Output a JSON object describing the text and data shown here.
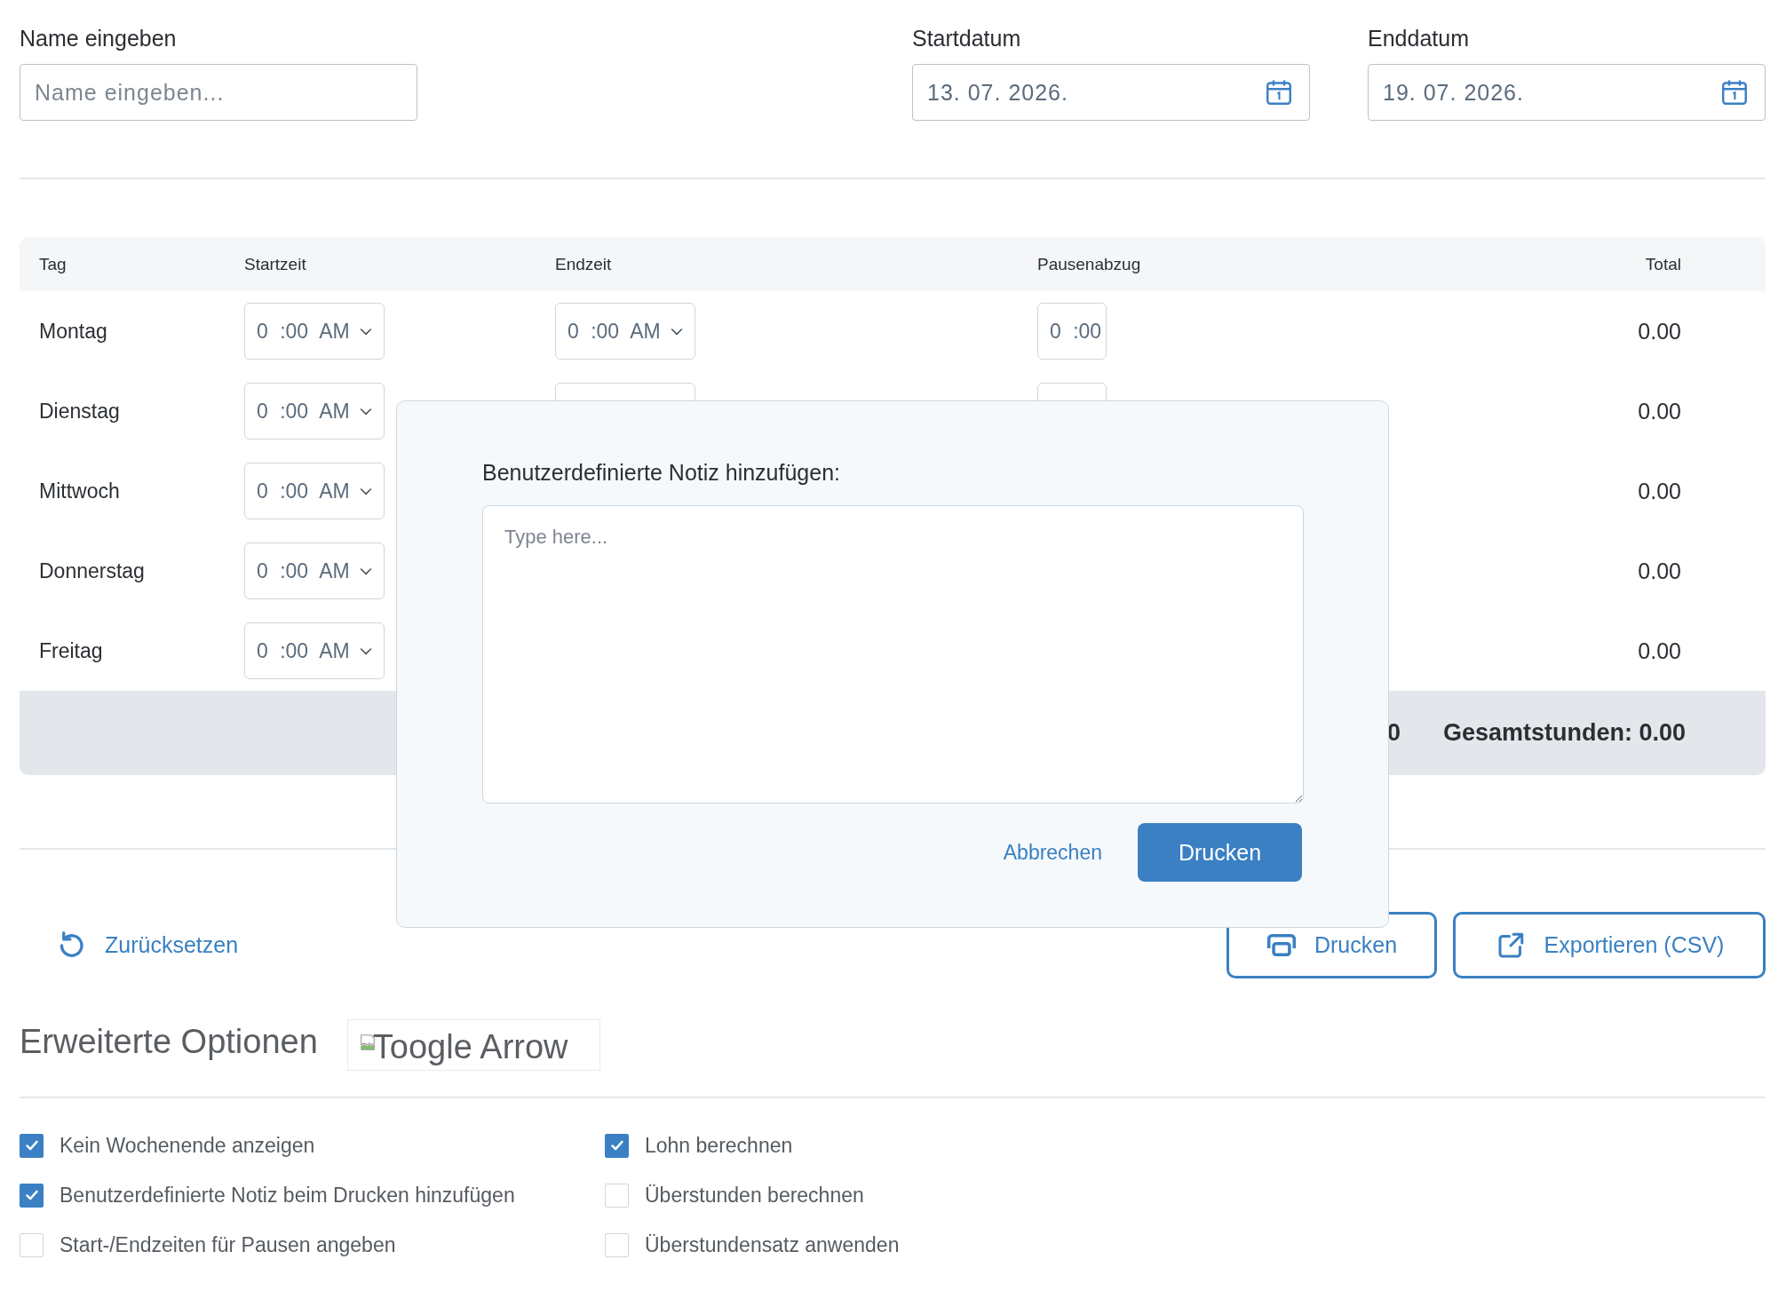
{
  "form": {
    "name_label": "Name eingeben",
    "name_placeholder": "Name eingeben...",
    "start_label": "Startdatum",
    "start_value": "13. 07. 2026.",
    "end_label": "Enddatum",
    "end_value": "19. 07. 2026."
  },
  "table": {
    "columns": [
      "Tag",
      "Startzeit",
      "Endzeit",
      "Pausenabzug",
      "Total"
    ],
    "rows": [
      {
        "day": "Montag",
        "start": "0 :00 AM",
        "end": "0 :00 AM",
        "pause": "0 :00",
        "total": "0.00"
      },
      {
        "day": "Dienstag",
        "start": "0 :00 AM",
        "total": "0.00"
      },
      {
        "day": "Mittwoch",
        "start": "0 :00 AM",
        "total": "0.00"
      },
      {
        "day": "Donnerstag",
        "start": "0 :00 AM",
        "total": "0.00"
      },
      {
        "day": "Freitag",
        "start": "0 :00 AM",
        "total": "0.00"
      }
    ],
    "footer": {
      "partial": "0",
      "total": "Gesamtstunden: 0.00"
    }
  },
  "actions": {
    "reset": "Zurücksetzen",
    "print": "Drucken",
    "export": "Exportieren (CSV)"
  },
  "advanced": {
    "title": "Erweiterte Optionen",
    "toggle_alt": "Toogle Arrow",
    "options": [
      {
        "label": "Kein Wochenende anzeigen",
        "checked": true
      },
      {
        "label": "Benutzerdefinierte Notiz beim Drucken hinzufügen",
        "checked": true
      },
      {
        "label": "Start-/Endzeiten für Pausen angeben",
        "checked": false
      },
      {
        "label": "Lohn berechnen",
        "checked": true
      },
      {
        "label": "Überstunden berechnen",
        "checked": false
      },
      {
        "label": "Überstundensatz anwenden",
        "checked": false
      }
    ]
  },
  "dialog": {
    "label": "Benutzerdefinierte Notiz hinzufügen:",
    "placeholder": "Type here...",
    "cancel": "Abbrechen",
    "confirm": "Drucken"
  }
}
